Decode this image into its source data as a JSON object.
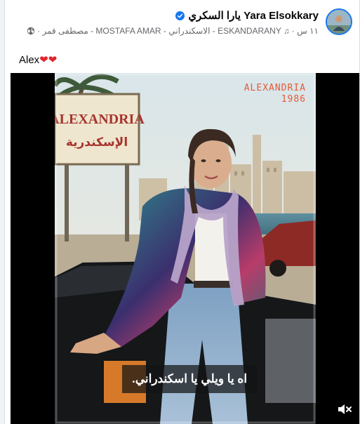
{
  "post": {
    "author": "Yara Elsokkary يارا السكري",
    "time": "١١ س",
    "music": "ESKANDARANY - الاسكندراني - MOSTAFA AMAR - مصطفى قمر",
    "text": "Alex",
    "emoji": "❤❤"
  },
  "video": {
    "watermark_city": "ALEXANDRIA",
    "watermark_year": "1986",
    "sign_en": "ALEXANDRIA",
    "sign_ar": "الإسكندرية",
    "caption": "اه يا ويلي يا اسكندراني."
  },
  "icons": {
    "verified": "verified-badge-icon",
    "music": "music-note-icon",
    "globe": "globe-icon",
    "mute": "speaker-muted-icon"
  },
  "colors": {
    "verified_blue": "#1877f2",
    "meta_gray": "#65676b",
    "watermark_orange": "#e45a3a"
  }
}
